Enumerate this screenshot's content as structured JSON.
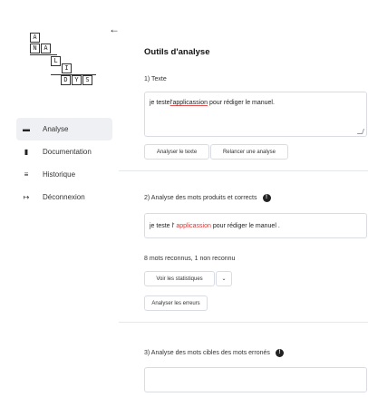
{
  "sidebar": {
    "collapse_glyph": "←",
    "logo_letters": {
      "row1": [
        "A"
      ],
      "row2": [
        "N",
        "A"
      ],
      "row3": [
        "L"
      ],
      "row4": [
        "I"
      ],
      "row5": [
        "D",
        "Y",
        "S"
      ]
    },
    "items": [
      {
        "label": "Analyse",
        "icon": "file-icon",
        "glyph": "▬",
        "active": true
      },
      {
        "label": "Documentation",
        "icon": "document-icon",
        "glyph": "▮",
        "active": false
      },
      {
        "label": "Historique",
        "icon": "list-icon",
        "glyph": "≡",
        "active": false
      },
      {
        "label": "Déconnexion",
        "icon": "logout-icon",
        "glyph": "↦",
        "active": false
      }
    ]
  },
  "main": {
    "title": "Outils d'analyse",
    "section1": {
      "label": "1) Texte",
      "text_before": "je teste ",
      "text_word": "l'applicassion",
      "text_after": " pour rédiger le manuel.",
      "analyze_button": "Analyser le texte",
      "restart_button": "Relancer une analyse"
    },
    "section2": {
      "label": "2) Analyse des mots produits et corrects",
      "info_glyph": "!",
      "text_before": "je teste l' ",
      "text_error": "applicassion",
      "text_after": " pour rédiger le manuel .",
      "summary": "8 mots reconnus, 1 non reconnu",
      "stats_button": "Voir les statistiques",
      "stats_chevron": "⌄",
      "errors_button": "Analyser les erreurs"
    },
    "section3": {
      "label": "3) Analyse des mots cibles des mots erronés",
      "info_glyph": "!"
    }
  }
}
